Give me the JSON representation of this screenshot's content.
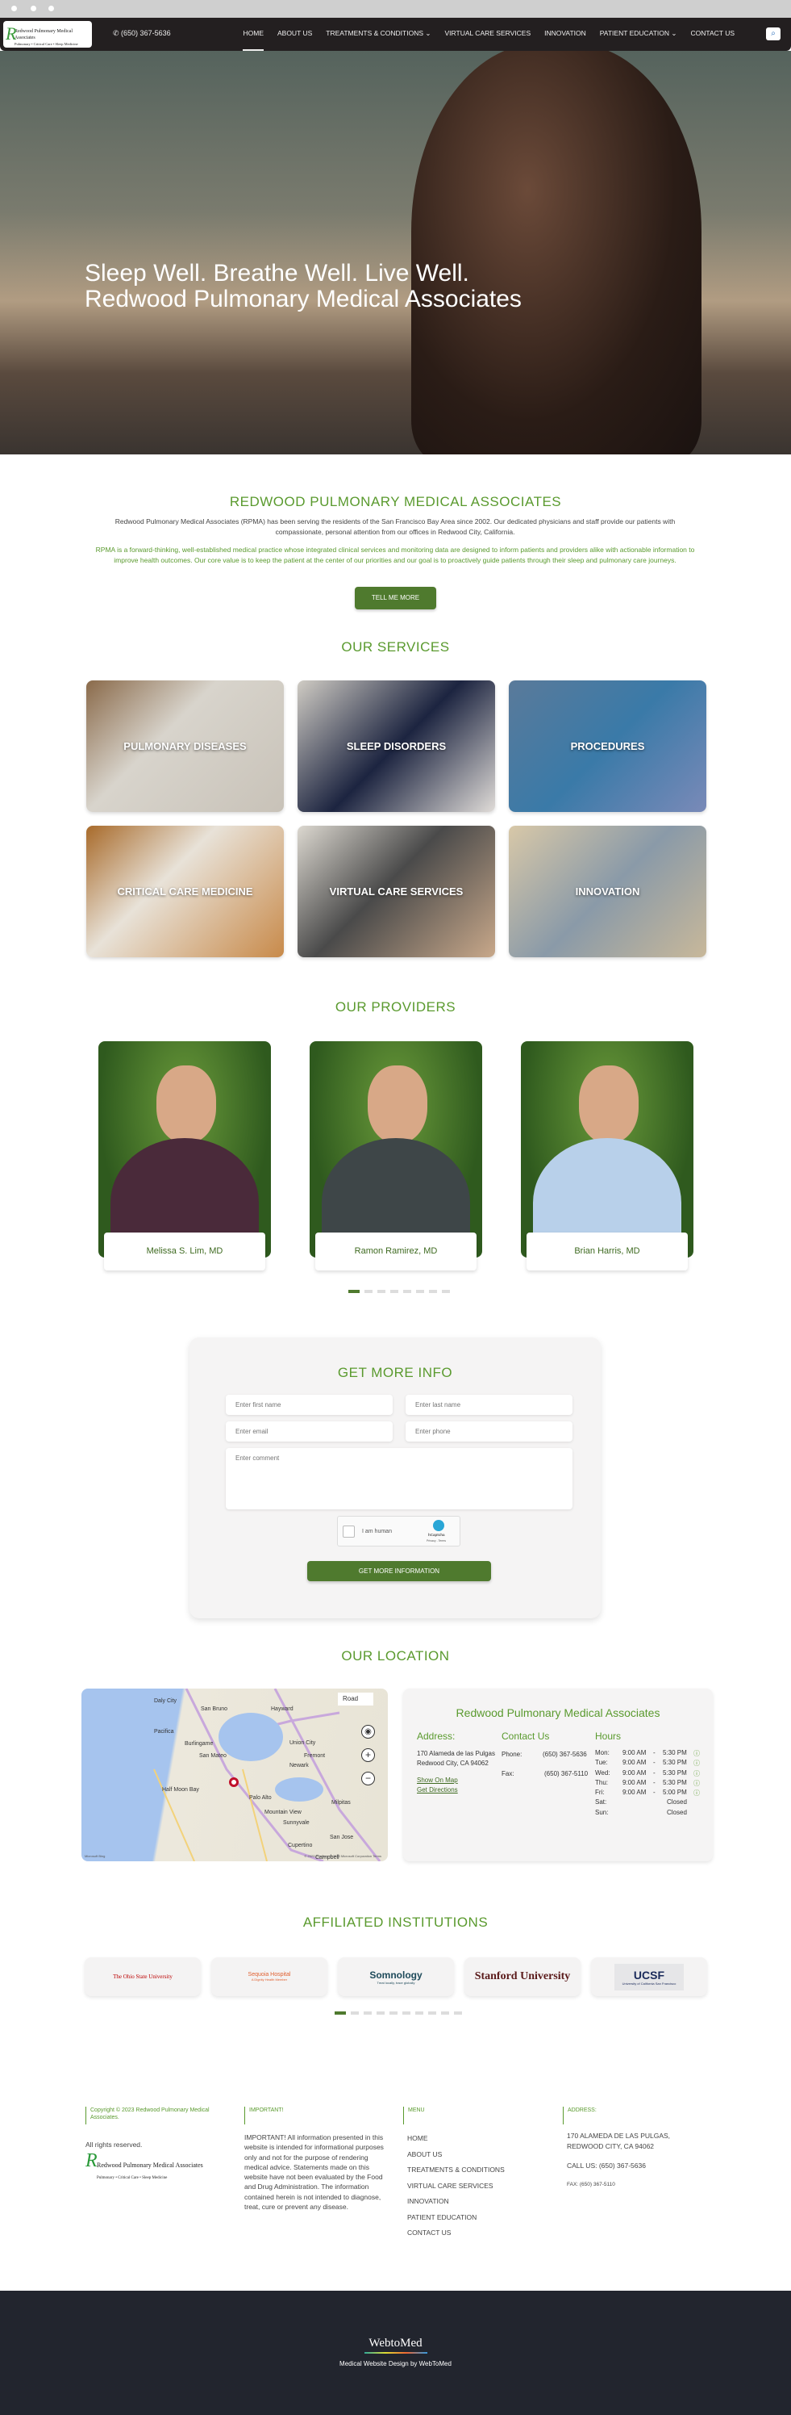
{
  "header": {
    "logo_text": "Redwood Pulmonary Medical Associates",
    "logo_tagline": "Pulmonary • Critical Care • Sleep Medicine",
    "phone": "(650) 367-5636",
    "nav": [
      {
        "label": "HOME",
        "active": true
      },
      {
        "label": "ABOUT US"
      },
      {
        "label": "TREATMENTS & CONDITIONS",
        "dropdown": true
      },
      {
        "label": "VIRTUAL CARE SERVICES"
      },
      {
        "label": "INNOVATION"
      },
      {
        "label": "PATIENT EDUCATION",
        "dropdown": true
      },
      {
        "label": "CONTACT US"
      }
    ],
    "search_icon": "search-icon"
  },
  "hero": {
    "line1": "Sleep Well. Breathe Well. Live Well.",
    "line2": "Redwood Pulmonary Medical Associates"
  },
  "intro": {
    "title": "REDWOOD PULMONARY MEDICAL ASSOCIATES",
    "p1": "Redwood Pulmonary Medical Associates (RPMA) has been serving the residents of the San Francisco Bay Area since 2002. Our dedicated physicians and staff provide our patients with compassionate, personal attention from our offices in Redwood City, California.",
    "p2": "RPMA is a forward-thinking, well-established medical practice whose integrated clinical services and monitoring data are designed to inform patients and providers alike with actionable information to improve health outcomes. Our core value is to keep the patient at the center of our priorities and our goal is to proactively guide patients through their sleep and pulmonary care journeys.",
    "button": "TELL ME MORE"
  },
  "services": {
    "title": "OUR SERVICES",
    "items": [
      "PULMONARY DISEASES",
      "SLEEP DISORDERS",
      "PROCEDURES",
      "CRITICAL CARE MEDICINE",
      "VIRTUAL CARE SERVICES",
      "INNOVATION"
    ]
  },
  "providers": {
    "title": "OUR PROVIDERS",
    "items": [
      "Melissa S. Lim, MD",
      "Ramon Ramirez, MD",
      "Brian Harris, MD"
    ],
    "dot_count": 8,
    "active_dot": 0
  },
  "form": {
    "title": "GET MORE INFO",
    "first_name": "Enter first name",
    "last_name": "Enter last name",
    "email": "Enter email",
    "phone": "Enter phone",
    "comment": "Enter comment",
    "captcha_label": "I am human",
    "captcha_brand": "hCaptcha",
    "captcha_links": "Privacy - Terms",
    "submit": "GET MORE INFORMATION"
  },
  "location": {
    "title": "OUR LOCATION",
    "map": {
      "type_button": "Road",
      "labels": [
        "Daly City",
        "San Bruno",
        "San Mateo",
        "Hayward",
        "Union City",
        "Fremont",
        "Newark",
        "Half Moon Bay",
        "Palo Alto",
        "Mountain View",
        "Sunnyvale",
        "Milpitas",
        "San Jose",
        "Cupertino",
        "Campbell",
        "Pacifica",
        "Burlingame"
      ],
      "credit": "© 2023 TomTom, © 2023 Microsoft Corporation Terms",
      "brand": "Microsoft Bing"
    },
    "name": "Redwood Pulmonary Medical Associates",
    "address_title": "Address:",
    "address_line1": "170 Alameda de las Pulgas",
    "address_line2": "Redwood City, CA 94062",
    "show_map": "Show On Map",
    "directions": "Get Directions",
    "contact_title": "Contact Us",
    "phone_label": "Phone:",
    "phone": "(650) 367-5636",
    "fax_label": "Fax:",
    "fax": "(650) 367-5110",
    "hours_title": "Hours",
    "hours": [
      {
        "day": "Mon:",
        "open": "9:00 AM",
        "close": "5:30 PM"
      },
      {
        "day": "Tue:",
        "open": "9:00 AM",
        "close": "5:30 PM"
      },
      {
        "day": "Wed:",
        "open": "9:00 AM",
        "close": "5:30 PM"
      },
      {
        "day": "Thu:",
        "open": "9:00 AM",
        "close": "5:30 PM"
      },
      {
        "day": "Fri:",
        "open": "9:00 AM",
        "close": "5:00 PM"
      },
      {
        "day": "Sat:",
        "closed": "Closed"
      },
      {
        "day": "Sun:",
        "closed": "Closed"
      }
    ]
  },
  "affiliated": {
    "title": "AFFILIATED INSTITUTIONS",
    "items": [
      "The Ohio State University",
      "Sequoia Hospital",
      "Somnology",
      "Stanford University",
      "UCSF"
    ],
    "somnology_tagline": "Treat locally, trace globally",
    "ucsf_sub": "University of California San Francisco",
    "sequoia_sub": "A Dignity Health Member",
    "dot_count": 10,
    "active_dot": 0
  },
  "footer": {
    "copyright": "Copyright © 2023 Redwood Pulmonary Medical Associates.",
    "rights": "All rights reserved.",
    "important_head": "IMPORTANT!",
    "important_text": "IMPORTANT! All information presented in this website is intended for informational purposes only and not for the purpose of rendering medical advice. Statements made on this website have not been evaluated by the Food and Drug Administration. The information contained herein is not intended to diagnose, treat, cure or prevent any disease.",
    "menu_head": "MENU",
    "menu": [
      "HOME",
      "ABOUT US",
      "TREATMENTS & CONDITIONS",
      "VIRTUAL CARE SERVICES",
      "INNOVATION",
      "PATIENT EDUCATION",
      "CONTACT US"
    ],
    "address_head": "ADDRESS:",
    "address1": "170 ALAMEDA DE LAS PULGAS,",
    "address2": "REDWOOD CITY, CA 94062",
    "call": "CALL US: (650) 367-5636",
    "fax": "FAX: (650) 367-5110"
  },
  "bottom": {
    "brand": "WebtoMed",
    "credit": "Medical Website Design by WebToMed"
  },
  "colors": {
    "accent": "#5a9a2e",
    "button": "#4f7a2e",
    "nav_bg": "#231f20",
    "footer_bg": "#22252e"
  }
}
